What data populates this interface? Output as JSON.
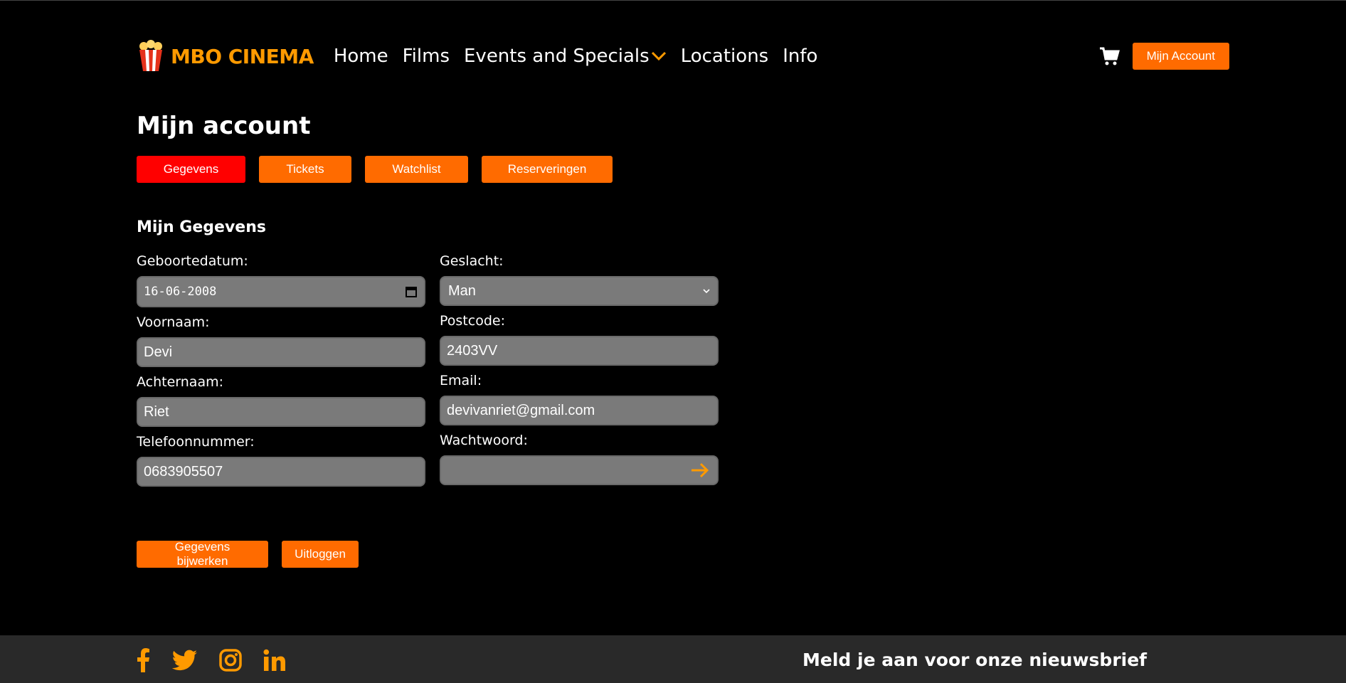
{
  "brand": {
    "name": "MBO CINEMA",
    "accent": "#ff9a00"
  },
  "nav": {
    "items": [
      {
        "label": "Home"
      },
      {
        "label": "Films"
      },
      {
        "label": "Events and Specials"
      },
      {
        "label": "Locations"
      },
      {
        "label": "Info"
      }
    ],
    "account_button": "Mijn Account"
  },
  "page": {
    "title": "Mijn account",
    "tabs": [
      {
        "label": "Gegevens",
        "active": true
      },
      {
        "label": "Tickets"
      },
      {
        "label": "Watchlist"
      },
      {
        "label": "Reserveringen"
      }
    ],
    "section_title": "Mijn Gegevens"
  },
  "form": {
    "birthdate": {
      "label": "Geboortedatum:",
      "value": "16-06-2008"
    },
    "gender": {
      "label": "Geslacht:",
      "value": "Man"
    },
    "firstname": {
      "label": "Voornaam:",
      "value": "Devi"
    },
    "postcode": {
      "label": "Postcode:",
      "value": "2403VV"
    },
    "lastname": {
      "label": "Achternaam:",
      "value": "Riet"
    },
    "email": {
      "label": "Email:",
      "value": "devivanriet@gmail.com"
    },
    "phone": {
      "label": "Telefoonnummer:",
      "value": "0683905507"
    },
    "password": {
      "label": "Wachtwoord:",
      "value": ""
    }
  },
  "actions": {
    "update": "Gegevens bijwerken",
    "logout": "Uitloggen"
  },
  "footer": {
    "socials": [
      "facebook-icon",
      "twitter-icon",
      "instagram-icon",
      "linkedin-icon"
    ],
    "newsletter_title": "Meld je aan voor onze nieuwsbrief"
  },
  "colors": {
    "button": "#ff6b00",
    "active_tab": "#ff0000",
    "input_bg": "#7a7a7a",
    "footer_bg": "#292929"
  }
}
